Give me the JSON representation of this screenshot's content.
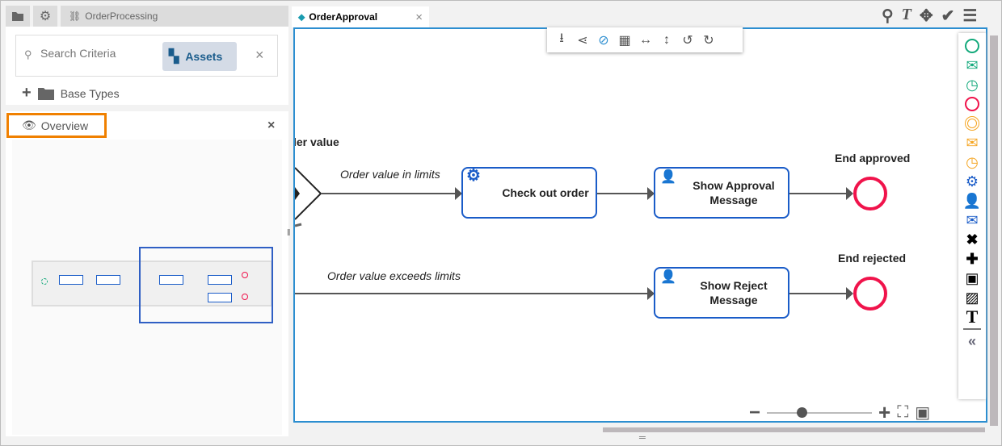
{
  "left_tabs": {
    "folder": "folder-icon",
    "settings": "gear-icon",
    "project": "OrderProcessing"
  },
  "search": {
    "placeholder": "Search Criteria",
    "assets_label": "Assets"
  },
  "tree": {
    "base_types": "Base Types"
  },
  "overview": {
    "title": "Overview"
  },
  "editor_tab": {
    "title": "OrderApproval"
  },
  "top_icons": [
    "search-icon",
    "text-icon",
    "move-icon",
    "validate-icon",
    "list-icon"
  ],
  "toolbar": [
    "export-icon",
    "share-icon",
    "hide-icon",
    "layout-icon",
    "fit-width-icon",
    "fit-height-icon",
    "undo-icon",
    "redo-icon"
  ],
  "diagram": {
    "gateway_label": "ler value",
    "flow_in_limits": "Order value in limits",
    "flow_exceeds": "Order value exceeds limits",
    "task_checkout": "Check out order",
    "task_approval": "Show Approval Message",
    "task_reject": "Show Reject Message",
    "end_approved": "End approved",
    "end_rejected": "End rejected"
  },
  "palette": [
    "start-event",
    "message-start-event",
    "timer-start-event",
    "end-event",
    "intermediate-event",
    "message-intermediate-event",
    "timer-intermediate-event",
    "service-task",
    "user-task",
    "message-task",
    "exclusive-gateway",
    "parallel-gateway",
    "contact-image",
    "image",
    "text",
    "collapse"
  ],
  "zoom": {
    "level_fraction": 0.33
  },
  "colors": {
    "accent": "#2c8ed0",
    "task_border": "#1a5cc8",
    "end_event": "#f0134b",
    "start_event": "#13a97b",
    "intermediate": "#f5a623",
    "highlight": "#f08000"
  }
}
